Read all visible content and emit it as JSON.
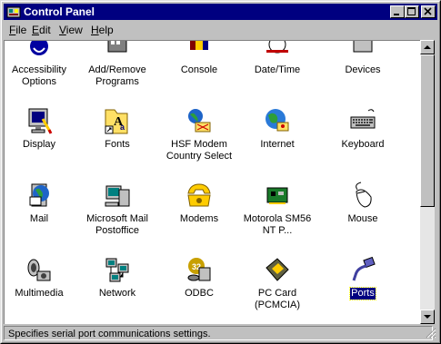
{
  "window": {
    "title": "Control Panel"
  },
  "menu": [
    {
      "label": "File",
      "accel": "F",
      "rest": "ile"
    },
    {
      "label": "Edit",
      "accel": "E",
      "rest": "dit"
    },
    {
      "label": "View",
      "accel": "V",
      "rest": "iew"
    },
    {
      "label": "Help",
      "accel": "H",
      "rest": "elp"
    }
  ],
  "items": [
    {
      "label": "Accessibility Options",
      "icon": "accessibility-icon"
    },
    {
      "label": "Add/Remove Programs",
      "icon": "add-remove-programs-icon"
    },
    {
      "label": "Console",
      "icon": "console-icon"
    },
    {
      "label": "Date/Time",
      "icon": "date-time-icon"
    },
    {
      "label": "Devices",
      "icon": "devices-icon"
    },
    {
      "label": "Display",
      "icon": "display-icon"
    },
    {
      "label": "Fonts",
      "icon": "fonts-icon"
    },
    {
      "label": "HSF Modem Country Select",
      "icon": "modem-country-icon"
    },
    {
      "label": "Internet",
      "icon": "internet-icon"
    },
    {
      "label": "Keyboard",
      "icon": "keyboard-icon"
    },
    {
      "label": "Mail",
      "icon": "mail-icon"
    },
    {
      "label": "Microsoft Mail Postoffice",
      "icon": "postoffice-icon"
    },
    {
      "label": "Modems",
      "icon": "modems-icon"
    },
    {
      "label": "Motorola SM56 NT P...",
      "icon": "motorola-card-icon"
    },
    {
      "label": "Mouse",
      "icon": "mouse-icon"
    },
    {
      "label": "Multimedia",
      "icon": "multimedia-icon"
    },
    {
      "label": "Network",
      "icon": "network-icon"
    },
    {
      "label": "ODBC",
      "icon": "odbc-icon"
    },
    {
      "label": "PC Card (PCMCIA)",
      "icon": "pc-card-icon"
    },
    {
      "label": "Ports",
      "icon": "ports-icon",
      "selected": true
    }
  ],
  "status": {
    "text": "Specifies serial port communications settings."
  }
}
